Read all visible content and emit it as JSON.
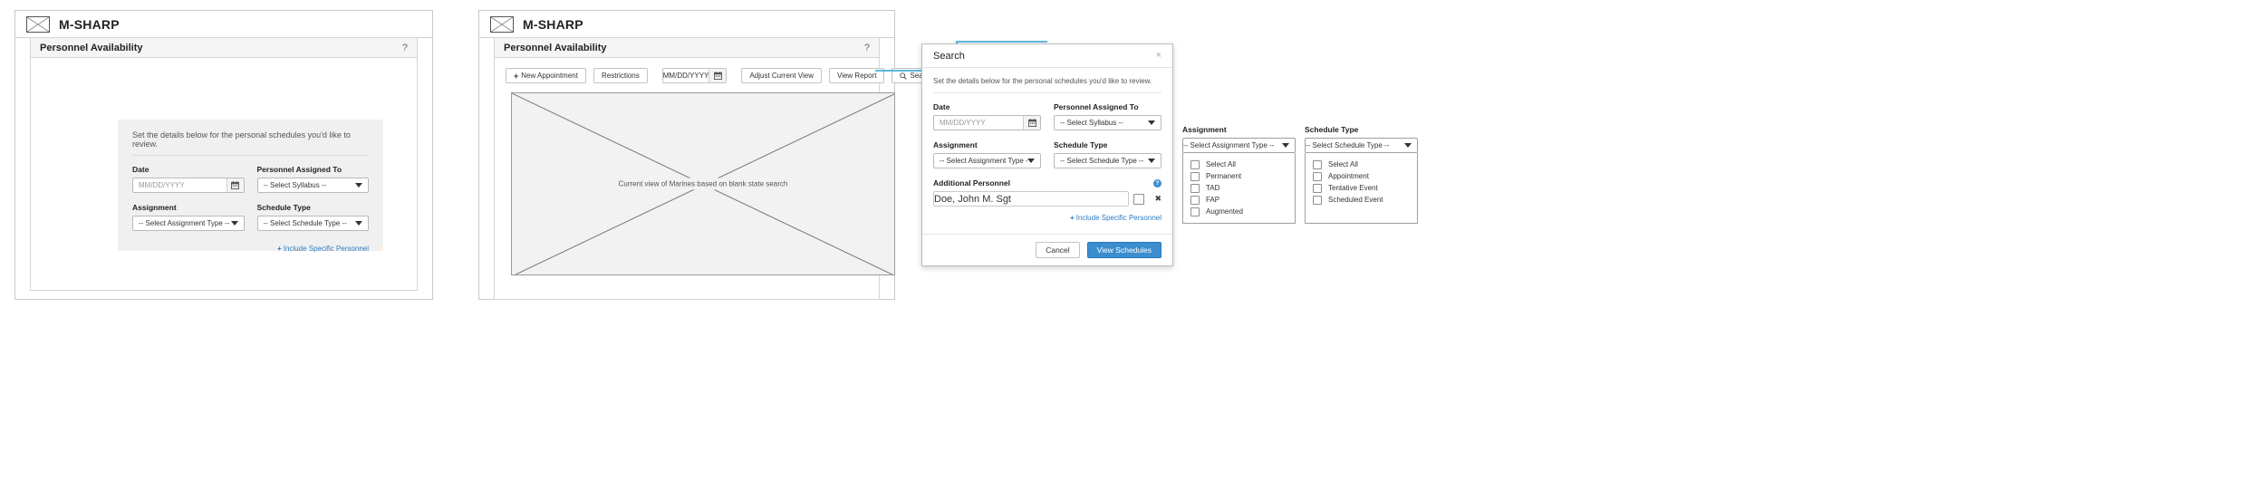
{
  "app": {
    "title": "M-SHARP",
    "logo_icon": "envelope-logo-icon"
  },
  "card": {
    "title": "Personnel Availability",
    "help_label": "?"
  },
  "form": {
    "intro": "Set the details below for the personal schedules you'd like to review.",
    "date_label": "Date",
    "date_placeholder": "MM/DD/YYYY",
    "personnel_label": "Personnel Assigned To",
    "personnel_value": "-- Select Syllabus --",
    "assignment_label": "Assignment",
    "assignment_value": "-- Select Assignment Type --",
    "schedule_label": "Schedule Type",
    "schedule_value": "-- Select Schedule Type --",
    "include_link": "Include Specific Personnel",
    "plus": "+",
    "calendar_icon": "calendar-icon",
    "caret_icon": "chevron-down-icon"
  },
  "toolbar": {
    "new_appointment": "New Appointment",
    "restrictions": "Restrictions",
    "date_placeholder": "MM/DD/YYYY",
    "adjust_current_view": "Adjust Current View",
    "view_report": "View Report",
    "search": "Search",
    "search_icon": "search-icon",
    "plus": "+"
  },
  "placeholder_view": {
    "label": "Current view of Marines based on blank state search"
  },
  "modal": {
    "title": "Search",
    "close_icon": "close-icon",
    "close_label": "×",
    "intro": "Set the details below for the personal schedules you'd like to review.",
    "date_label": "Date",
    "date_placeholder": "MM/DD/YYYY",
    "personnel_label": "Personnel Assigned To",
    "personnel_value": "-- Select Syllabus --",
    "assignment_label": "Assignment",
    "assignment_value": "-- Select Assignment Type --",
    "schedule_label": "Schedule Type",
    "schedule_value": "-- Select Schedule Type --",
    "additional_personnel_label": "Additional Personnel",
    "additional_personnel_placeholder": "Doe, John M. Sgt",
    "help_icon_label": "?",
    "remove_label": "✖",
    "include_link": "Include Specific Personnel",
    "plus": "+",
    "cancel_label": "Cancel",
    "submit_label": "View Schedules"
  },
  "dropdowns": {
    "assignment": {
      "label": "Assignment",
      "selected": "-- Select Assignment Type --",
      "options": [
        "Select All",
        "Permanent",
        "TAD",
        "FAP",
        "Augmented"
      ]
    },
    "schedule_type": {
      "label": "Schedule Type",
      "selected": "-- Select Schedule Type --",
      "options": [
        "Select All",
        "Appointment",
        "Tentative Event",
        "Scheduled Event"
      ]
    }
  },
  "colors": {
    "accent": "#3c8dcd",
    "link": "#2b7cc4",
    "panel_bg": "#f0f0f0",
    "header_bg": "#f5f5f5",
    "border": "#c8c8c8"
  }
}
